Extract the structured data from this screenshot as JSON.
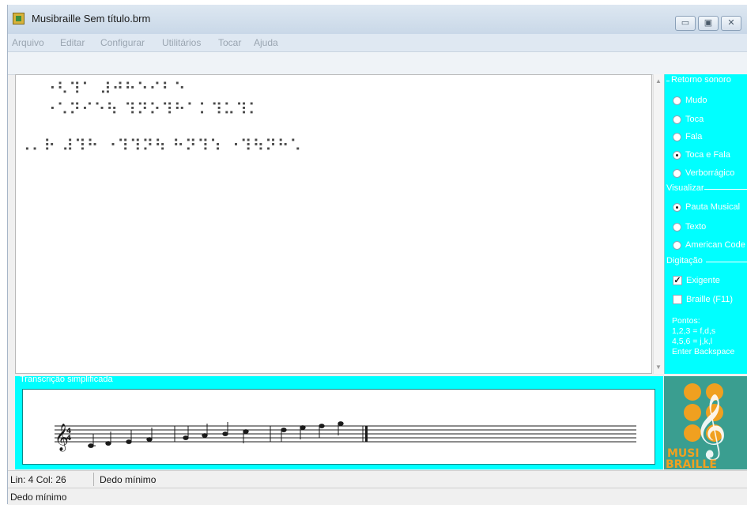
{
  "window": {
    "title": "Musibraille Sem título.brm",
    "controls": [
      "minimize",
      "maximize",
      "close"
    ]
  },
  "menu": [
    "Arquivo",
    "Editar",
    "Configurar",
    "Utilitários",
    "Tocar",
    "Ajuda"
  ],
  "editor": {
    "lines": [
      "⠐⠣⠹⠁ ⠼⠚⠓⠑⠊⠃⠑",
      "⠐⠡⠝⠊⠑⠳ ⠹⠝⠕⠹⠓⠁⠅⠹⠥⠹⠅",
      "",
      "⠠⠄⠗ ⠼⠹⠓ ⠐⠹⠹⠝⠳ ⠓⠝⠹⠱ ⠐⠹⠳⠝⠓⠡"
    ]
  },
  "panel": {
    "retorno": {
      "title": "Retorno sonoro",
      "options": [
        {
          "label": "Mudo",
          "selected": false
        },
        {
          "label": "Toca",
          "selected": false
        },
        {
          "label": "Fala",
          "selected": false
        },
        {
          "label": "Toca e Fala",
          "selected": true
        },
        {
          "label": "Verborrágico",
          "selected": false
        }
      ]
    },
    "visualizar": {
      "title": "Visualizar",
      "options": [
        {
          "label": "Pauta Musical",
          "selected": true
        },
        {
          "label": "Texto",
          "selected": false
        },
        {
          "label": "American Code",
          "selected": false
        }
      ]
    },
    "digitacao": {
      "title": "Digitação",
      "exigente": {
        "label": "Exigente",
        "checked": true
      },
      "braille": {
        "label": "Braille (F11)",
        "checked": false
      },
      "pontos": [
        "Pontos:",
        "1,2,3 = f,d,s",
        "4,5,6 = j,k,l",
        "Enter  Backspace"
      ]
    }
  },
  "transcription": {
    "title": "Transcrição simplificada",
    "time_signature": "4/4"
  },
  "logo": {
    "line1": "MUSI",
    "line2": "BRAILLE"
  },
  "status": {
    "position": "Lin: 4 Col: 26",
    "finger": "Dedo mínimo",
    "message": "Dedo mínimo"
  },
  "colors": {
    "panel": "#00ffff",
    "logo_bg": "#3a9e90",
    "logo_dots": "#f0a020"
  }
}
